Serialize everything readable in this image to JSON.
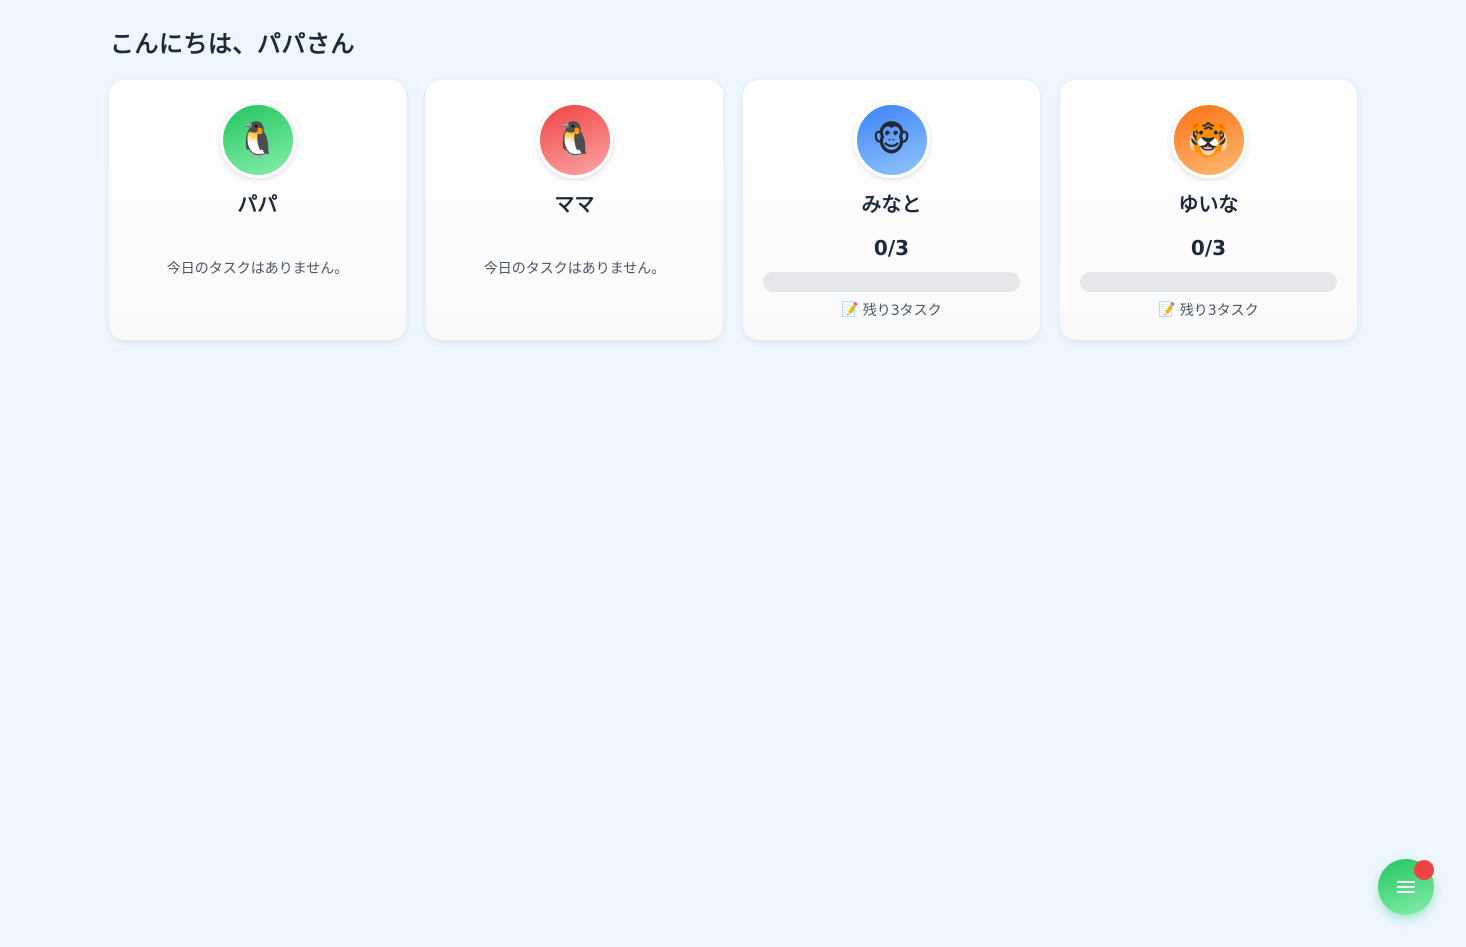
{
  "greeting": "こんにちは、パパさん",
  "members": [
    {
      "name": "パパ",
      "avatar_emoji": "🐧",
      "avatar_icon": "penguin-icon",
      "avatar_gradient": [
        "#22c55e",
        "#86efac"
      ],
      "has_tasks": false,
      "empty_text": "今日のタスクはありません。"
    },
    {
      "name": "ママ",
      "avatar_emoji": "🐧",
      "avatar_icon": "penguin-icon",
      "avatar_gradient": [
        "#ef4444",
        "#fca5a5"
      ],
      "has_tasks": false,
      "empty_text": "今日のタスクはありません。"
    },
    {
      "name": "みなと",
      "avatar_emoji": "🐵",
      "avatar_icon": "monkey-icon",
      "avatar_gradient": [
        "#3b82f6",
        "#93c5fd"
      ],
      "has_tasks": true,
      "count_text": "0/3",
      "progress": 0,
      "remaining_emoji": "📝",
      "remaining_text": "残り3タスク"
    },
    {
      "name": "ゆいな",
      "avatar_emoji": "🐯",
      "avatar_icon": "tiger-icon",
      "avatar_gradient": [
        "#f97316",
        "#fdba74"
      ],
      "has_tasks": true,
      "count_text": "0/3",
      "progress": 0,
      "remaining_emoji": "📝",
      "remaining_text": "残り3タスク"
    }
  ],
  "fab": {
    "icon": "menu-icon",
    "has_notification": true,
    "notification_color": "#ef4444"
  }
}
